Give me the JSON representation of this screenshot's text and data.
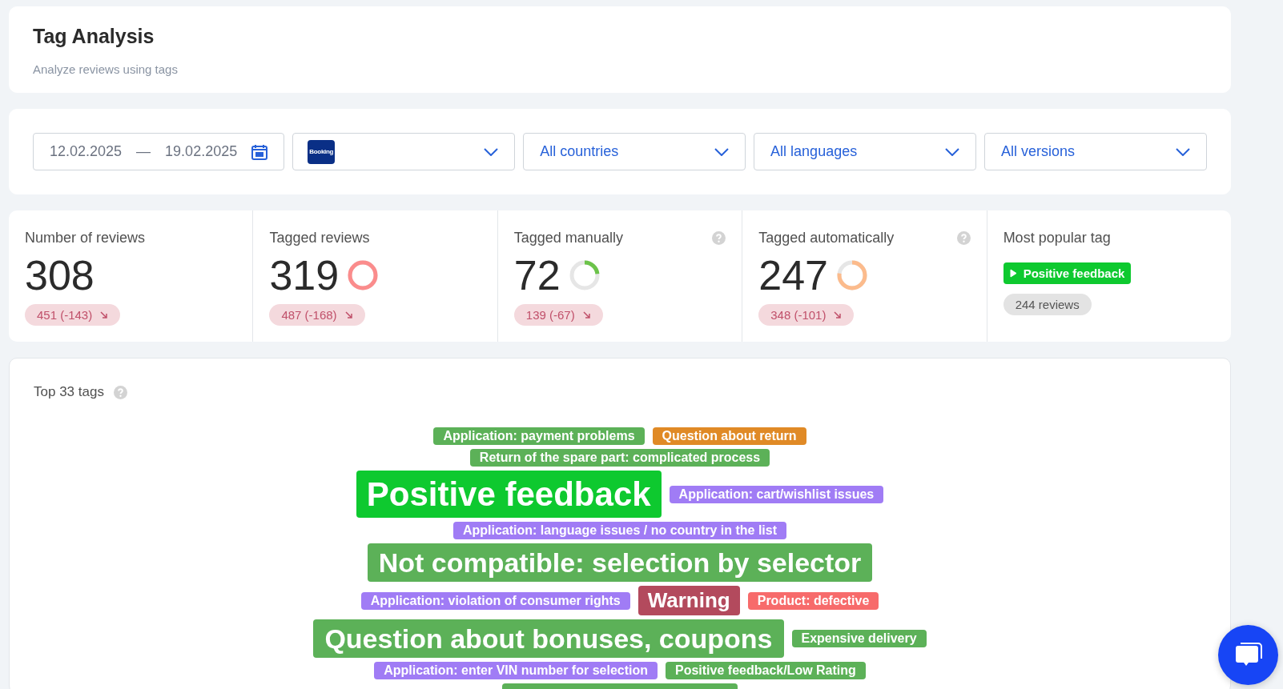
{
  "header": {
    "title": "Tag Analysis",
    "subtitle": "Analyze reviews using tags"
  },
  "filters": {
    "date_from": "12.02.2025",
    "date_separator": "—",
    "date_to": "19.02.2025",
    "app_logo": "Booking",
    "dropdowns": [
      "All countries",
      "All languages",
      "All versions"
    ]
  },
  "stats": [
    {
      "label": "Number of reviews",
      "value": "308",
      "change": "451 (-143)",
      "help": false
    },
    {
      "label": "Tagged reviews",
      "value": "319",
      "change": "487 (-168)",
      "help": false,
      "ring": {
        "level": 1,
        "color": "#fb8c8c"
      }
    },
    {
      "label": "Tagged manually",
      "value": "72",
      "change": "139 (-67)",
      "help": true,
      "ring": {
        "level": 0.23,
        "color": "#6cc34a"
      }
    },
    {
      "label": "Tagged automatically",
      "value": "247",
      "change": "348 (-101)",
      "help": true,
      "ring": {
        "level": 0.77,
        "color": "#fcbb8c"
      }
    }
  ],
  "popular": {
    "label": "Most popular tag",
    "tag": "Positive feedback",
    "count": "244 reviews"
  },
  "cloud": {
    "title": "Top 33 tags",
    "rows": [
      [
        {
          "label": "Application: payment problems",
          "color": "#5cb158",
          "kind": "s"
        },
        {
          "label": "Question about return",
          "color": "#e08a26",
          "kind": "s"
        }
      ],
      [
        {
          "label": "Return of the spare part: complicated process",
          "color": "#5cb158",
          "kind": "s"
        }
      ],
      [
        {
          "label": "Positive feedback",
          "color": "#0ec92f",
          "kind": "xl"
        },
        {
          "label": "Application: cart/wishlist issues",
          "color": "#a07cf5",
          "kind": "s"
        }
      ],
      [
        {
          "label": "Application: language issues / no country in the list",
          "color": "#a07cf5",
          "kind": "s"
        }
      ],
      [
        {
          "label": "Not compatible: selection by selector",
          "color": "#5cb158",
          "kind": "l"
        }
      ],
      [
        {
          "label": "Application: violation of consumer rights",
          "color": "#a07cf5",
          "kind": "s"
        },
        {
          "label": "Warning",
          "color": "#b34a5d",
          "kind": "m"
        },
        {
          "label": "Product: defective",
          "color": "#f76b6b",
          "kind": "s"
        }
      ],
      [
        {
          "label": "Question about bonuses, coupons",
          "color": "#5cb158",
          "kind": "l"
        },
        {
          "label": "Expensive delivery",
          "color": "#5cb158",
          "kind": "s"
        }
      ],
      [
        {
          "label": "Application: enter VIN number for selection",
          "color": "#a07cf5",
          "kind": "s"
        },
        {
          "label": "Positive feedback/Low Rating",
          "color": "#5cb158",
          "kind": "s"
        }
      ],
      [
        {
          "color": "#5cb158",
          "kind": "s",
          "cut": true
        }
      ]
    ]
  }
}
